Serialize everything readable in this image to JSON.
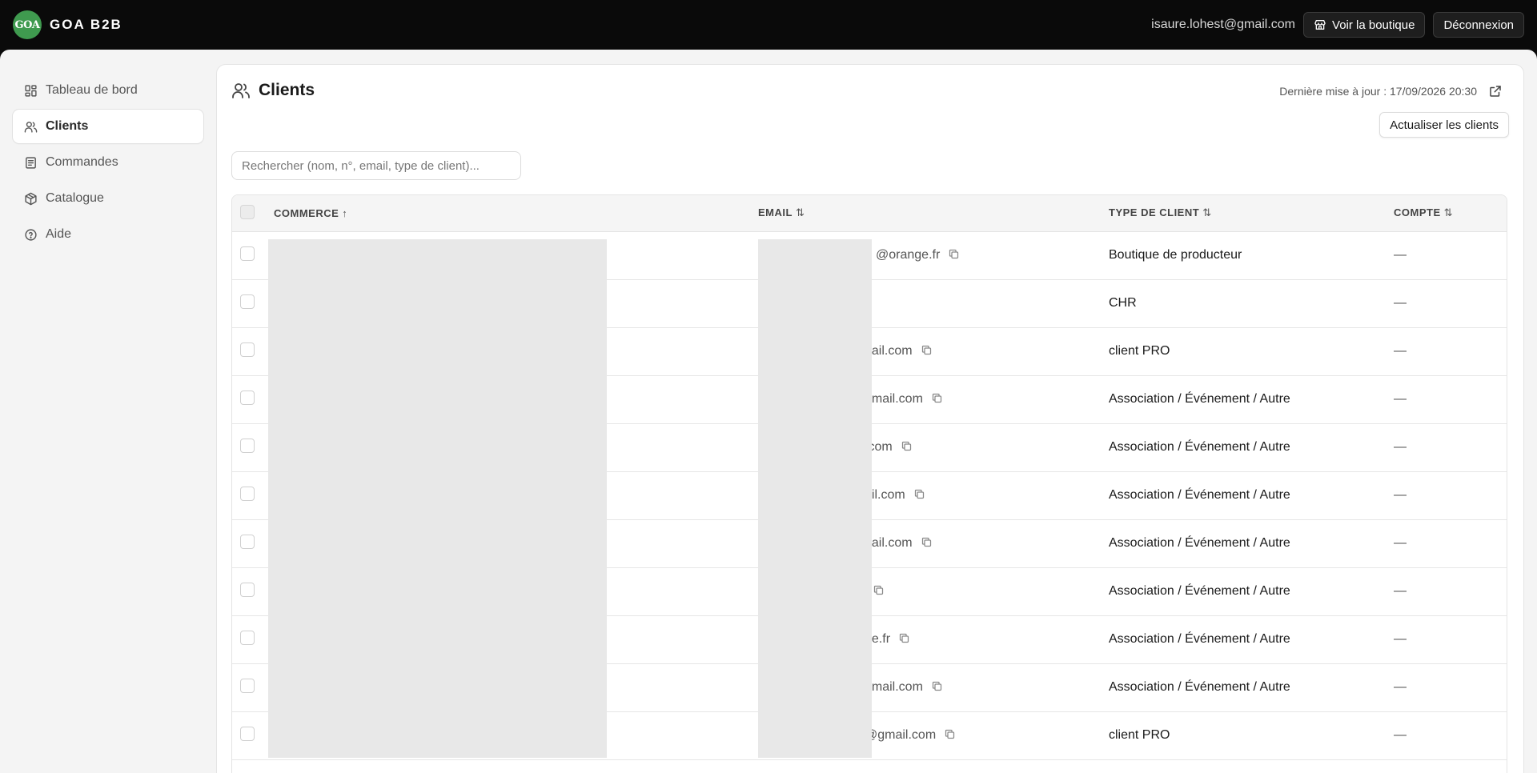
{
  "brand": {
    "logo_text": "GOA",
    "name": "GOA B2B",
    "accent": "#3f9a4f"
  },
  "header": {
    "user_email": "isaure.lohest@gmail.com",
    "shop_button": "Voir la boutique",
    "logout_button": "Déconnexion"
  },
  "sidebar": {
    "items": [
      {
        "label": "Tableau de bord",
        "icon": "dashboard-icon"
      },
      {
        "label": "Clients",
        "icon": "users-icon",
        "active": true
      },
      {
        "label": "Commandes",
        "icon": "document-icon"
      },
      {
        "label": "Catalogue",
        "icon": "package-icon"
      },
      {
        "label": "Aide",
        "icon": "help-circle-icon"
      }
    ]
  },
  "page": {
    "title": "Clients",
    "last_update": "Dernière mise à jour : 17/09/2026 20:30",
    "refresh_button": "Actualiser les clients",
    "search_placeholder": "Rechercher (nom, n°, email, type de client)..."
  },
  "table": {
    "columns": [
      "COMMERCE",
      "EMAIL",
      "TYPE DE CLIENT",
      "COMPTE"
    ],
    "sort_indicators": [
      "↑",
      "⇅",
      "⇅",
      "⇅"
    ],
    "rows": [
      {
        "commerce": "",
        "email": "@orange.fr",
        "type": "Boutique de producteur",
        "compte": "—"
      },
      {
        "commerce": "",
        "email": "",
        "type": "CHR",
        "compte": "—"
      },
      {
        "commerce": "",
        "email": "nail.com",
        "type": "client PRO",
        "compte": "—"
      },
      {
        "commerce": "",
        "email": "gmail.com",
        "type": "Association / Événement / Autre",
        "compte": "—"
      },
      {
        "commerce": "",
        "email": ".com",
        "type": "Association / Événement / Autre",
        "compte": "—"
      },
      {
        "commerce": "",
        "email": "ail.com",
        "type": "Association / Événement / Autre",
        "compte": "—"
      },
      {
        "commerce": "",
        "email": "nail.com",
        "type": "Association / Événement / Autre",
        "compte": "—"
      },
      {
        "commerce": "",
        "email": "",
        "type": "Association / Événement / Autre",
        "compte": "—"
      },
      {
        "commerce": "",
        "email": "ge.fr",
        "type": "Association / Événement / Autre",
        "compte": "—"
      },
      {
        "commerce": "",
        "email": "gmail.com",
        "type": "Association / Événement / Autre",
        "compte": "—"
      },
      {
        "commerce": "",
        "email": "@gmail.com",
        "type": "client PRO",
        "compte": "—"
      }
    ]
  }
}
